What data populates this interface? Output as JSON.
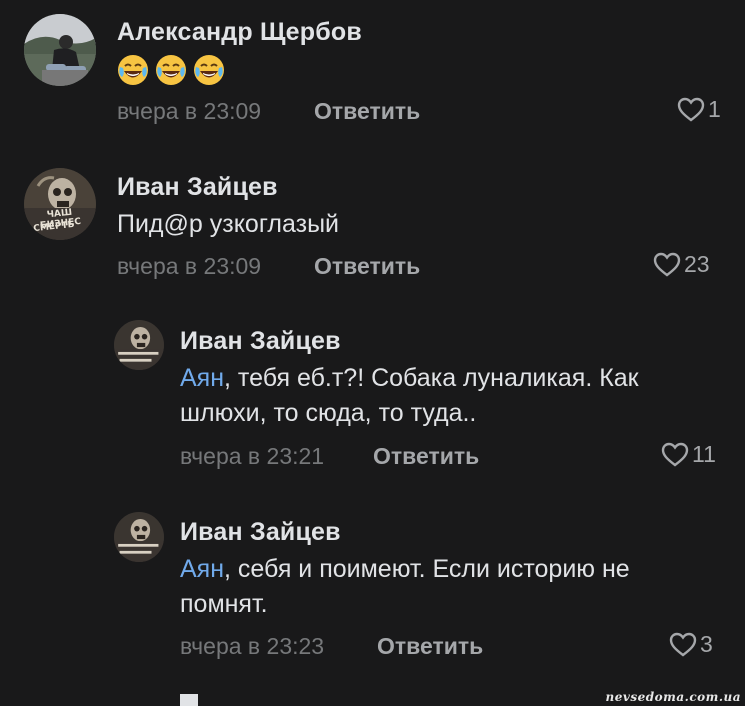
{
  "comments": [
    {
      "author": "Александр Щербов",
      "emoji": [
        "face-with-tears-of-joy",
        "face-with-tears-of-joy",
        "face-with-tears-of-joy"
      ],
      "time": "вчера в 23:09",
      "reply_label": "Ответить",
      "likes": "1"
    },
    {
      "author": "Иван Зайцев",
      "text": "Пид@р узкоглазый",
      "time": "вчера в 23:09",
      "reply_label": "Ответить",
      "likes": "23",
      "avatar_caption_top": "ЧАШ БИЗНЕС",
      "avatar_caption_bottom": "СМЕРТЬ"
    },
    {
      "author": "Иван Зайцев",
      "mention": "Аян",
      "text_line1": ", тебя еб.т?! Собака луналикая. Как",
      "text_line2": "шлюхи, то сюда, то туда..",
      "time": "вчера в 23:21",
      "reply_label": "Ответить",
      "likes": "11"
    },
    {
      "author": "Иван Зайцев",
      "mention": "Аян",
      "text_line1": ", себя и поимеют. Если историю не",
      "text_line2": "помнят.",
      "time": "вчера в 23:23",
      "reply_label": "Ответить",
      "likes": "3"
    }
  ],
  "watermark": "nevsedoma.com.ua",
  "colors": {
    "background": "#19191a",
    "text": "#e1e3e6",
    "secondary": "#76787a",
    "mention": "#71aaeb"
  }
}
